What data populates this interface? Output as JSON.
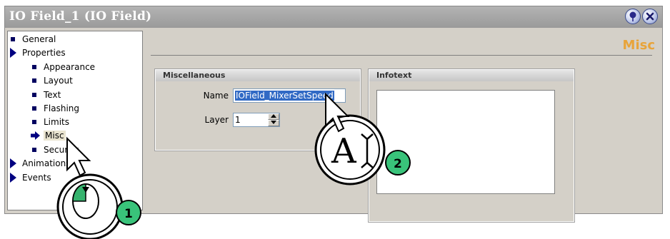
{
  "window": {
    "title": "IO Field_1 (IO Field)"
  },
  "nav": {
    "items": [
      {
        "label": "General",
        "marker": "bullet"
      },
      {
        "label": "Properties",
        "marker": "triangle"
      },
      {
        "label": "Appearance",
        "marker": "bullet"
      },
      {
        "label": "Layout",
        "marker": "bullet"
      },
      {
        "label": "Text",
        "marker": "bullet"
      },
      {
        "label": "Flashing",
        "marker": "bullet"
      },
      {
        "label": "Limits",
        "marker": "bullet"
      },
      {
        "label": "Misc",
        "marker": "arrow",
        "selected": true
      },
      {
        "label": "Security",
        "marker": "bullet"
      },
      {
        "label": "Animations",
        "marker": "triangle"
      },
      {
        "label": "Events",
        "marker": "triangle"
      }
    ]
  },
  "page": {
    "heading": "Misc"
  },
  "miscellaneous": {
    "title": "Miscellaneous",
    "name_label": "Name",
    "name_value": "IOField_MixerSetSpeed",
    "layer_label": "Layer",
    "layer_value": "1"
  },
  "infotext": {
    "title": "Infotext",
    "value": ""
  },
  "callouts": {
    "step1": "1",
    "step2": "2",
    "text_cursor_glyph": "A"
  },
  "colors": {
    "heading": "#e8a43a",
    "badge": "#39c37a",
    "selection": "#316ac5",
    "titlebar": "#a6a6a6"
  }
}
